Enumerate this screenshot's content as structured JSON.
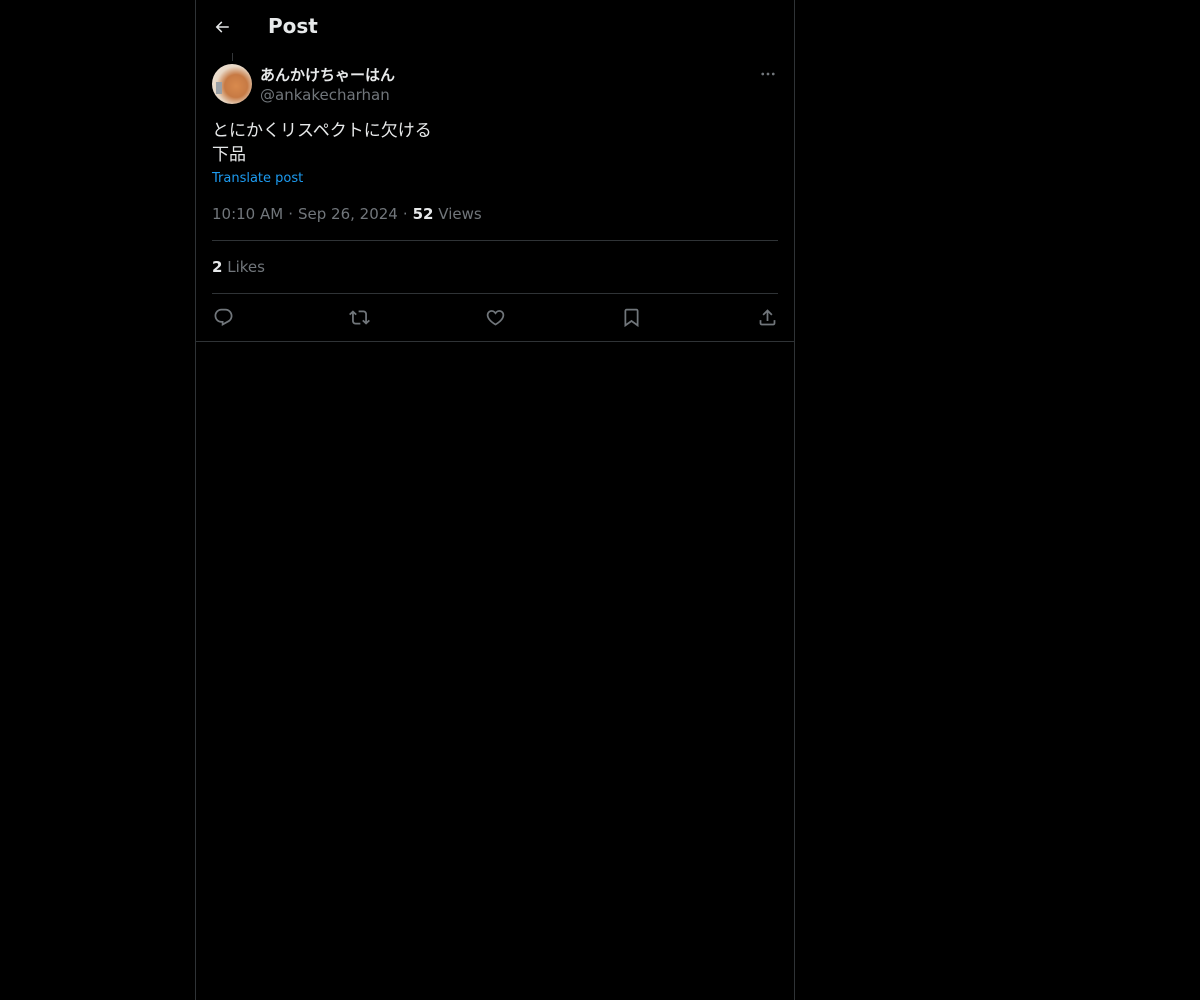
{
  "header": {
    "title": "Post"
  },
  "author": {
    "name": "あんかけちゃーはん",
    "handle": "@ankakecharhan"
  },
  "post": {
    "text_line1": "とにかくリスペクトに欠ける",
    "text_line2": "下品",
    "translate_label": "Translate post",
    "time": "10:10 AM",
    "date": "Sep 26, 2024",
    "separator": "·",
    "views_count": "52",
    "views_label": "Views",
    "likes_count": "2",
    "likes_label": "Likes"
  },
  "actions": {
    "reply": "reply-icon",
    "repost": "repost-icon",
    "like": "heart-icon",
    "bookmark": "bookmark-icon",
    "share": "share-icon"
  },
  "colors": {
    "background": "#000000",
    "text": "#e7e9ea",
    "secondary": "#71767b",
    "link": "#1d9bf0",
    "border": "#2f3336"
  }
}
